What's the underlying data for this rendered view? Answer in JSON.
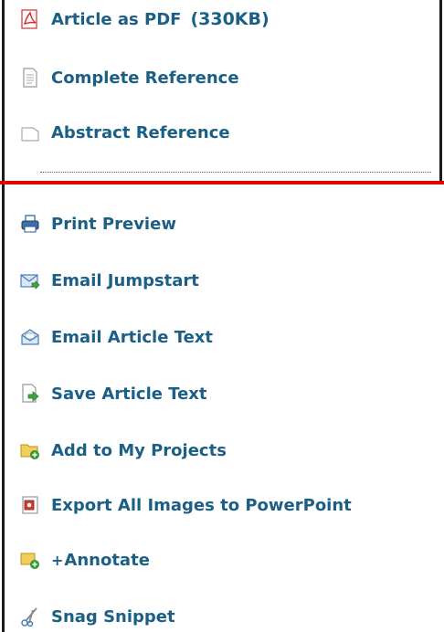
{
  "top_links": [
    {
      "label": "Article as PDF",
      "size": "(330KB)",
      "icon": "pdf-icon"
    },
    {
      "label": "Complete Reference",
      "icon": "document-icon"
    },
    {
      "label": "Abstract Reference",
      "icon": "blank-document-icon"
    }
  ],
  "tools": [
    {
      "label": "Print Preview",
      "icon": "printer-icon"
    },
    {
      "label": "Email Jumpstart",
      "icon": "email-icon"
    },
    {
      "label": "Email Article Text",
      "icon": "email-open-icon"
    },
    {
      "label": "Save Article Text",
      "icon": "save-document-icon"
    },
    {
      "label": "Add to My Projects",
      "icon": "folder-add-icon"
    },
    {
      "label": "Export All Images to PowerPoint",
      "icon": "powerpoint-icon"
    },
    {
      "label": "Annotate",
      "prefix": "+",
      "icon": "annotate-icon"
    },
    {
      "label": "Snag Snippet",
      "icon": "scissors-icon"
    }
  ],
  "colors": {
    "link": "#1b5f86",
    "separator": "#e00000",
    "frame": "#1a1a1a"
  }
}
